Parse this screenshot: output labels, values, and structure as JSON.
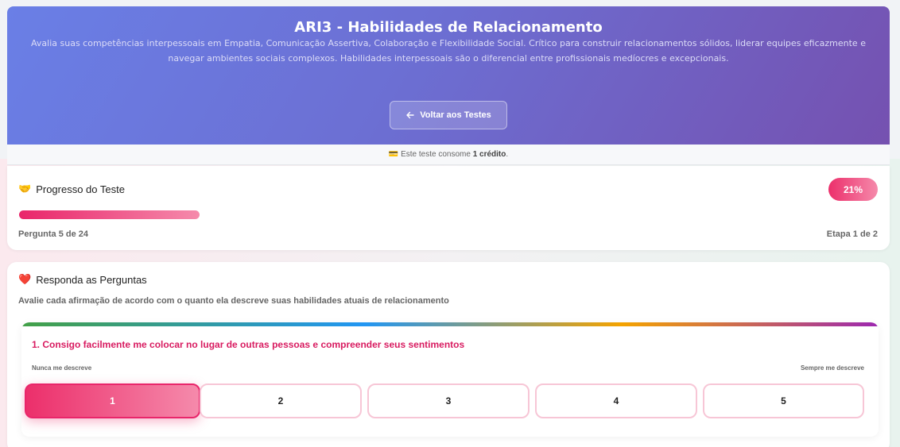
{
  "header": {
    "title": "ARI3 - Habilidades de Relacionamento",
    "description": "Avalia suas competências interpessoais em Empatia, Comunicação Assertiva, Colaboração e Flexibilidade Social. Crítico para construir relacionamentos sólidos, liderar equipes eficazmente e navegar ambientes sociais complexos. Habilidades interpessoais são o diferencial entre profissionais medíocres e excepcionais.",
    "back_button": "Voltar aos Testes"
  },
  "credit": {
    "icon": "💳",
    "prefix": "Este teste consome",
    "amount": "1 crédito",
    "suffix": "."
  },
  "progress": {
    "icon": "🤝",
    "title": "Progresso do Teste",
    "percent_label": "21%",
    "percent_value": 21,
    "question_label": "Pergunta 5 de 24",
    "stage_label": "Etapa 1 de 2"
  },
  "questions": {
    "icon": "❤️",
    "title": "Responda as Perguntas",
    "subtitle": "Avalie cada afirmação de acordo com o quanto ela descreve suas habilidades atuais de relacionamento",
    "items": [
      {
        "text": "1. Consigo facilmente me colocar no lugar de outras pessoas e compreender seus sentimentos",
        "scale_low": "Nunca me descreve",
        "scale_high": "Sempre me descreve",
        "options": [
          "1",
          "2",
          "3",
          "4",
          "5"
        ],
        "selected": "1"
      }
    ]
  },
  "colors": {
    "accent_pink": "#e9256a",
    "hero_start": "#6a7fe6",
    "hero_end": "#7551b0"
  }
}
